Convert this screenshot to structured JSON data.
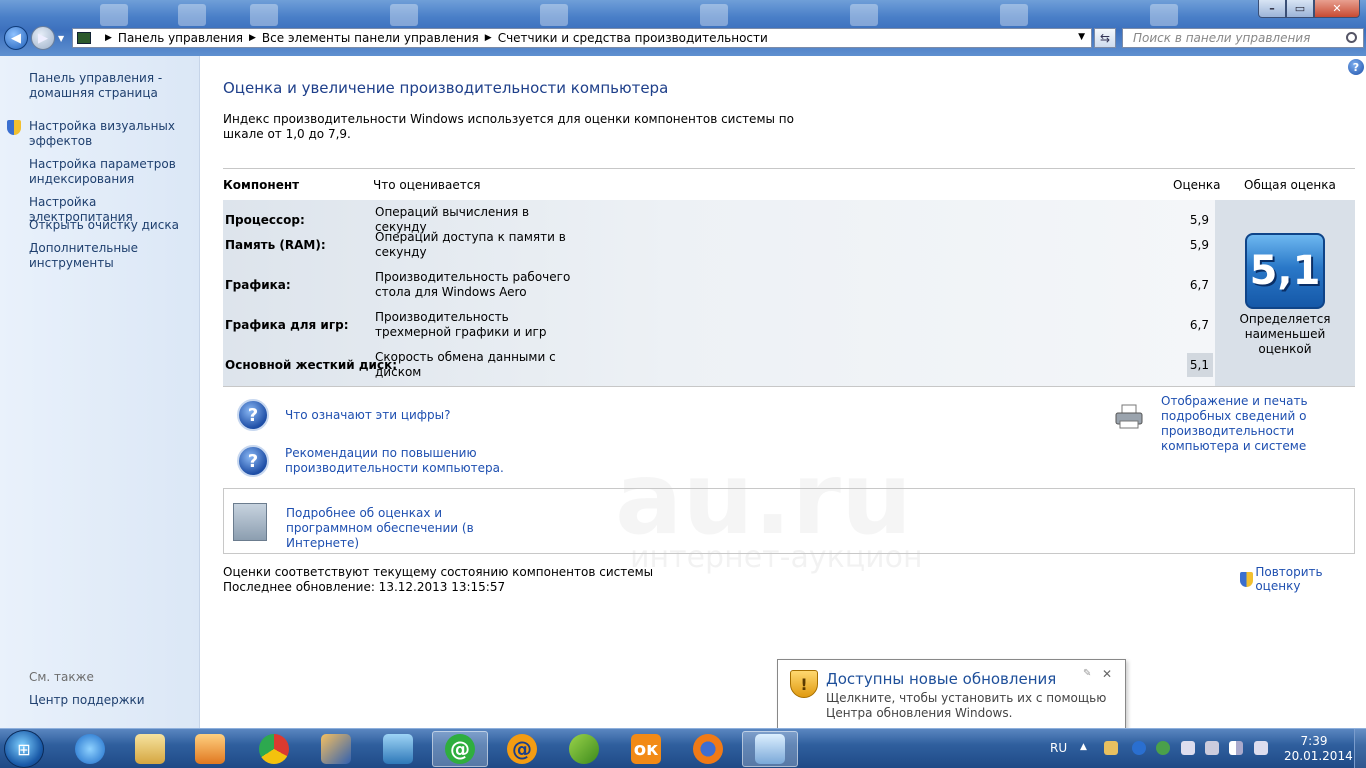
{
  "address": {
    "crumbs": [
      "Панель управления",
      "Все элементы панели управления",
      "Счетчики и средства производительности"
    ],
    "search_placeholder": "Поиск в панели управления"
  },
  "sidebar": {
    "home": "Панель управления - домашняя страница",
    "items": [
      "Настройка визуальных эффектов",
      "Настройка параметров индексирования",
      "Настройка электропитания",
      "Открыть очистку диска",
      "Дополнительные инструменты"
    ],
    "see_also": "См. также",
    "support": "Центр поддержки"
  },
  "main": {
    "title": "Оценка и увеличение производительности компьютера",
    "intro": "Индекс производительности Windows используется для оценки компонентов системы по шкале от 1,0 до 7,9.",
    "table": {
      "headers": {
        "component": "Компонент",
        "rated": "Что оценивается",
        "score": "Оценка",
        "base": "Общая оценка"
      },
      "rows": [
        {
          "component": "Процессор:",
          "rated": "Операций вычисления в секунду",
          "score": "5,9"
        },
        {
          "component": "Память (RAM):",
          "rated": "Операций доступа к памяти в секунду",
          "score": "5,9"
        },
        {
          "component": "Графика:",
          "rated": "Производительность рабочего стола для Windows Aero",
          "score": "6,7"
        },
        {
          "component": "Графика для игр:",
          "rated": "Производительность трехмерной графики и игр",
          "score": "6,7"
        },
        {
          "component": "Основной жесткий диск:",
          "rated": "Скорость обмена данными с диском",
          "score": "5,1"
        }
      ],
      "base_score": "5,1",
      "base_label": "Определяется наименьшей оценкой"
    },
    "links": {
      "what_numbers": "Что означают эти цифры?",
      "tips": "Рекомендации по повышению производительности компьютера.",
      "print_details": "Отображение и печать подробных сведений о производительности компьютера и системе",
      "learn_more": "Подробнее об оценках и программном обеспечении (в Интернете)"
    },
    "status_line1": "Оценки соответствуют текущему состоянию компонентов системы",
    "status_line2": "Последнее обновление: 13.12.2013 13:15:57",
    "rerun": "Повторить оценку"
  },
  "watermark": {
    "logo": "au.ru",
    "tagline": "интернет-аукцион"
  },
  "balloon": {
    "title": "Доступны новые обновления",
    "text": "Щелкните, чтобы установить их с помощью Центра обновления Windows."
  },
  "taskbar": {
    "apps": [
      "internet-explorer",
      "file-explorer",
      "media-player",
      "chrome",
      "app-orange",
      "app-blue",
      "mail-agent",
      "mail-agent-2",
      "app-green",
      "odnoklassniki",
      "firefox",
      "control-panel"
    ],
    "lang": "RU",
    "time": "7:39",
    "date": "20.01.2014"
  },
  "colors": {
    "link": "#1e4fb0",
    "title": "#1e3f8a",
    "badge": "#2a78c8"
  }
}
